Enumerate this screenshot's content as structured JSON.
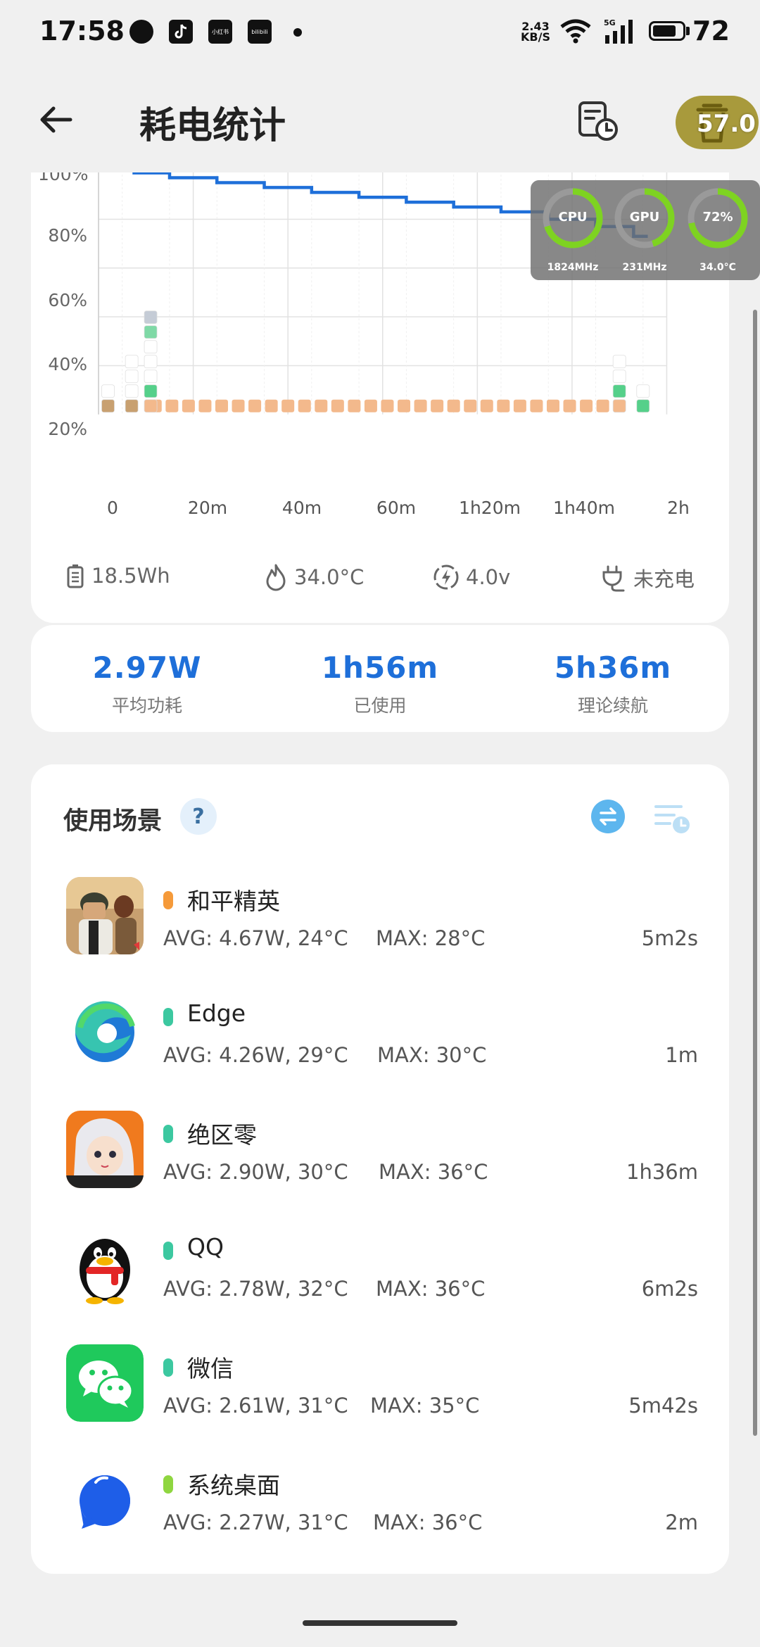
{
  "status_bar": {
    "time": "17:58",
    "net_speed_value": "2.43",
    "net_speed_unit": "KB/S",
    "network_type": "5G",
    "battery_level": "72",
    "notification_icons": [
      "chat-bubble-icon",
      "tiktok-icon",
      "xiaohongshu-icon",
      "bilibili-icon",
      "dot-icon"
    ],
    "notif_texts": [
      "小红书",
      "bilibili"
    ]
  },
  "header": {
    "title": "耗电统计",
    "score": "57.0"
  },
  "chart": {
    "y_ticks": [
      "100%",
      "80%",
      "60%",
      "40%",
      "20%"
    ],
    "x_ticks": [
      "0",
      "20m",
      "40m",
      "60m",
      "1h20m",
      "1h40m",
      "2h"
    ],
    "specs": {
      "capacity": "18.5Wh",
      "temperature": "34.0°C",
      "voltage": "4.0v",
      "charging": "未充电"
    }
  },
  "chart_data": {
    "type": "line",
    "x": [
      0,
      5,
      10,
      20,
      30,
      40,
      50,
      60,
      70,
      80,
      90,
      100,
      110,
      116
    ],
    "series": [
      {
        "values": [
          100,
          100,
          99,
          97,
          95,
          93,
          91,
          89,
          87,
          85,
          83,
          80,
          77,
          73
        ]
      }
    ],
    "xlabel": "",
    "ylabel": "",
    "ylim": [
      0,
      100
    ],
    "xlim": [
      0,
      120
    ],
    "y_tick_values": [
      20,
      40,
      60,
      80,
      100
    ],
    "x_tick_values": [
      0,
      20,
      40,
      60,
      80,
      100,
      120
    ],
    "grid": true,
    "color": "#1e6fd9"
  },
  "overlay": {
    "cpu": {
      "label": "CPU",
      "sub": "1824MHz",
      "fraction": 0.7
    },
    "gpu": {
      "label": "GPU",
      "sub": "231MHz",
      "fraction": 0.45
    },
    "battery": {
      "label": "72%",
      "sub": "34.0°C",
      "fraction": 0.72
    }
  },
  "stats": [
    {
      "value": "2.97W",
      "label": "平均功耗"
    },
    {
      "value": "1h56m",
      "label": "已使用"
    },
    {
      "value": "5h36m",
      "label": "理论续航"
    }
  ],
  "scenes": {
    "title": "使用场景",
    "help": "?",
    "items": [
      {
        "name": "和平精英",
        "avg": "AVG: 4.67W, 24°C",
        "max": "MAX:  28°C",
        "duration": "5m2s",
        "dot_color": "#f59a3a",
        "icon": "peace-elite-game-icon"
      },
      {
        "name": "Edge",
        "avg": "AVG: 4.26W, 29°C",
        "max": "MAX:  30°C",
        "duration": "1m",
        "dot_color": "#3cc8a0",
        "icon": "edge-browser-icon"
      },
      {
        "name": "绝区零",
        "avg": "AVG: 2.90W, 30°C",
        "max": "MAX:  36°C",
        "duration": "1h36m",
        "dot_color": "#3cc8a0",
        "icon": "zenless-zone-zero-icon"
      },
      {
        "name": "QQ",
        "avg": "AVG: 2.78W, 32°C",
        "max": "MAX:  36°C",
        "duration": "6m2s",
        "dot_color": "#3cc8a0",
        "icon": "qq-penguin-icon"
      },
      {
        "name": "微信",
        "avg": "AVG: 2.61W, 31°C",
        "max": "MAX:  35°C",
        "duration": "5m42s",
        "dot_color": "#3cc8a0",
        "icon": "wechat-icon"
      },
      {
        "name": "系统桌面",
        "avg": "AVG: 2.27W, 31°C",
        "max": "MAX:  36°C",
        "duration": "2m",
        "dot_color": "#8fd640",
        "icon": "system-launcher-icon"
      }
    ]
  },
  "colors": {
    "accent": "#1e6fd9",
    "gauge_green": "#7ed321",
    "score_pill": "#a89a3c"
  }
}
